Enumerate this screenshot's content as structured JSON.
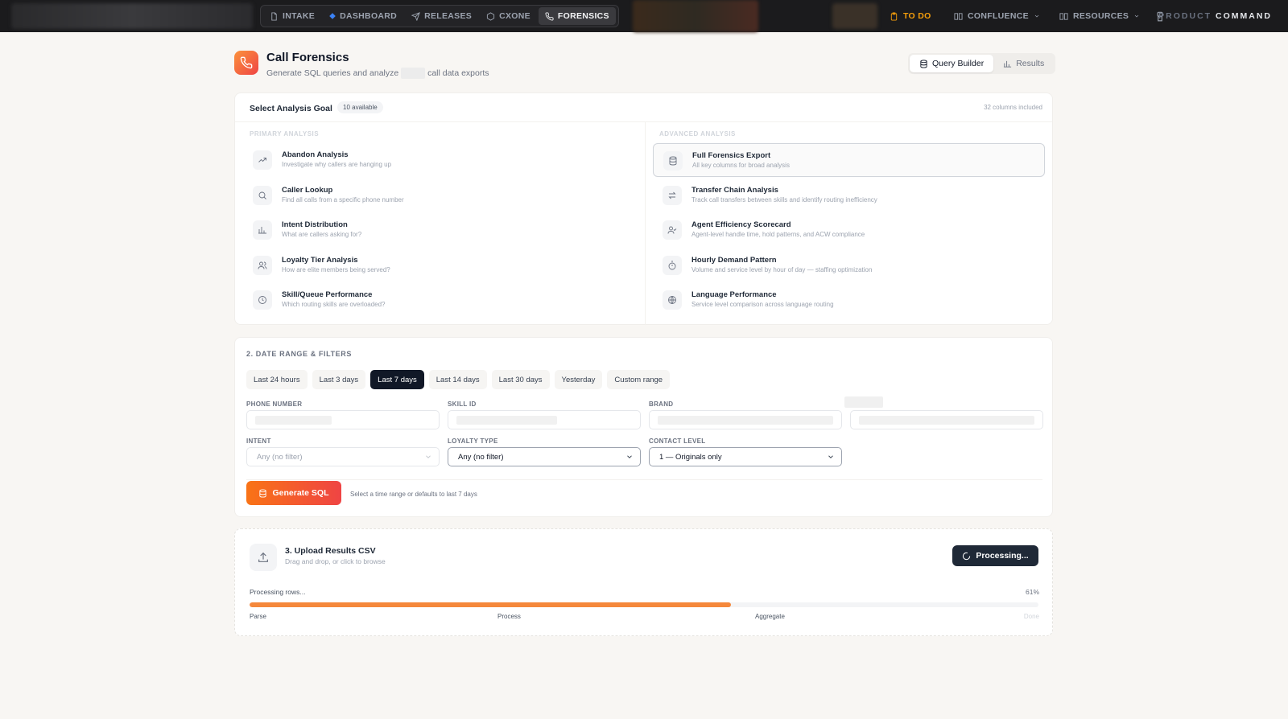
{
  "topbar": {
    "nav": [
      {
        "label": "INTAKE",
        "icon": "document-icon"
      },
      {
        "label": "DASHBOARD",
        "icon": "diamond-icon"
      },
      {
        "label": "RELEASES",
        "icon": "send-icon"
      },
      {
        "label": "CXONE",
        "icon": "hexagon-icon"
      },
      {
        "label": "FORENSICS",
        "icon": "phone-icon",
        "active": true
      }
    ],
    "todo": "TO DO",
    "confluence": "CONFLUENCE",
    "resources": "RESOURCES",
    "brand_light": "PRODUCT",
    "brand_bold": "COMMAND"
  },
  "header": {
    "title": "Call Forensics",
    "subtitle_prefix": "Generate SQL queries and analyze",
    "subtitle_suffix": "call data exports",
    "views": [
      "Query Builder",
      "Results"
    ]
  },
  "goals": {
    "title": "Select Analysis Goal",
    "badge": "10 available",
    "columns_included": "32 columns included",
    "primary_label": "PRIMARY ANALYSIS",
    "advanced_label": "ADVANCED ANALYSIS",
    "primary": [
      {
        "title": "Abandon Analysis",
        "desc": "Investigate why callers are hanging up",
        "icon": "trending-up-icon"
      },
      {
        "title": "Caller Lookup",
        "desc": "Find all calls from a specific phone number",
        "icon": "search-icon"
      },
      {
        "title": "Intent Distribution",
        "desc": "What are callers asking for?",
        "icon": "bar-chart-icon"
      },
      {
        "title": "Loyalty Tier Analysis",
        "desc": "How are elite members being served?",
        "icon": "users-icon"
      },
      {
        "title": "Skill/Queue Performance",
        "desc": "Which routing skills are overloaded?",
        "icon": "clock-icon"
      }
    ],
    "advanced": [
      {
        "title": "Full Forensics Export",
        "desc": "All key columns for broad analysis",
        "icon": "database-icon",
        "selected": true
      },
      {
        "title": "Transfer Chain Analysis",
        "desc": "Track call transfers between skills and identify routing inefficiency",
        "icon": "transfer-icon"
      },
      {
        "title": "Agent Efficiency Scorecard",
        "desc": "Agent-level handle time, hold patterns, and ACW compliance",
        "icon": "user-check-icon"
      },
      {
        "title": "Hourly Demand Pattern",
        "desc": "Volume and service level by hour of day — staffing optimization",
        "icon": "timer-icon"
      },
      {
        "title": "Language Performance",
        "desc": "Service level comparison across language routing",
        "icon": "globe-icon"
      }
    ]
  },
  "filters": {
    "title": "2. DATE RANGE & FILTERS",
    "ranges": [
      "Last 24 hours",
      "Last 3 days",
      "Last 7 days",
      "Last 14 days",
      "Last 30 days",
      "Yesterday",
      "Custom range"
    ],
    "active_range": "Last 7 days",
    "phone_label": "PHONE NUMBER",
    "skill_label": "SKILL ID",
    "brand_label": "BRAND",
    "intent_label": "INTENT",
    "intent_value": "Any (no filter)",
    "loyalty_label": "LOYALTY TYPE",
    "loyalty_value": "Any (no filter)",
    "contact_label": "CONTACT LEVEL",
    "contact_value": "1 — Originals only",
    "generate_label": "Generate SQL",
    "hint": "Select a time range or defaults to last 7 days"
  },
  "upload": {
    "title": "3. Upload Results CSV",
    "subtitle": "Drag and drop, or click to browse",
    "button": "Processing...",
    "progress_label": "Processing rows...",
    "progress_percent": 61,
    "progress_text": "61%",
    "stages": [
      {
        "label": "Parse",
        "done": true
      },
      {
        "label": "Process",
        "done": true
      },
      {
        "label": "Aggregate",
        "done": true
      },
      {
        "label": "Done",
        "done": false
      }
    ]
  },
  "colors": {
    "accent": "#f97316",
    "dark": "#1f2937",
    "todo": "#f59e0b"
  }
}
